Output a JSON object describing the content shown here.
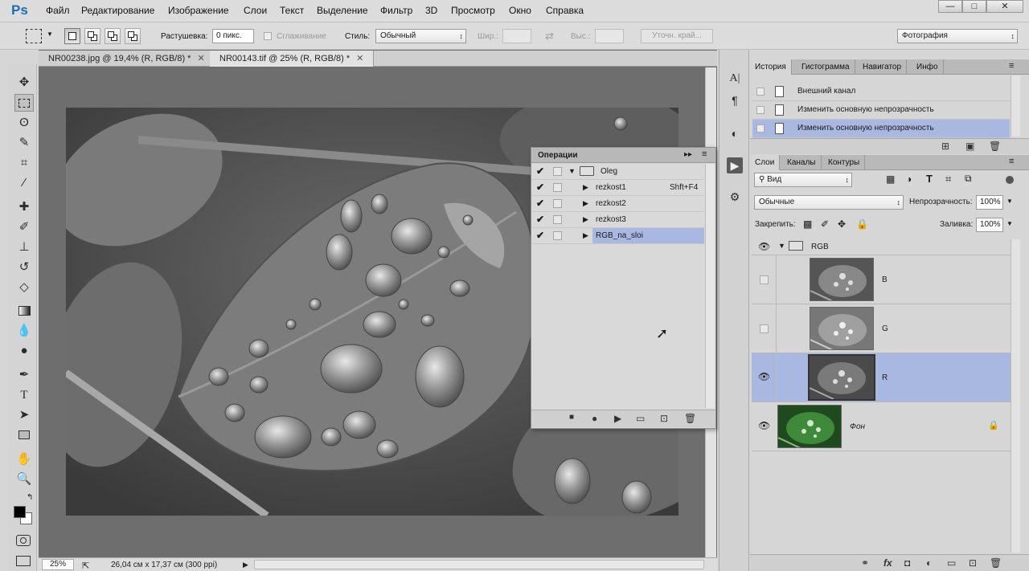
{
  "app": {
    "logo": "Ps"
  },
  "menu": [
    "Файл",
    "Редактирование",
    "Изображение",
    "Слои",
    "Текст",
    "Выделение",
    "Фильтр",
    "3D",
    "Просмотр",
    "Окно",
    "Справка"
  ],
  "window_controls": {
    "minimize": "—",
    "maximize": "□",
    "close": "✕"
  },
  "options": {
    "feather_label": "Растушевка:",
    "feather_value": "0 пикс.",
    "antialias_label": "Сглаживание",
    "style_label": "Стиль:",
    "style_value": "Обычный",
    "width_label": "Шир.:",
    "height_label": "Выс.:",
    "refine_edge_label": "Уточн. край...",
    "workspace_value": "Фотография"
  },
  "document_tabs": [
    {
      "label": "NR00238.jpg @ 19,4% (R, RGB/8) *",
      "close": "✕",
      "active": false
    },
    {
      "label": "NR00143.tif @ 25% (R, RGB/8) *",
      "close": "✕",
      "active": true
    }
  ],
  "status": {
    "zoom": "25%",
    "doc_info": "26,04 см x 17,37 см (300 ppi)"
  },
  "actions_panel": {
    "title": "Операции",
    "rows": [
      {
        "label": "Oleg",
        "type": "set",
        "shortcut": "",
        "selected": false
      },
      {
        "label": "rezkost1",
        "type": "action",
        "shortcut": "Shft+F4",
        "selected": false
      },
      {
        "label": "rezkost2",
        "type": "action",
        "shortcut": "",
        "selected": false
      },
      {
        "label": "rezkost3",
        "type": "action",
        "shortcut": "",
        "selected": false
      },
      {
        "label": "RGB_na_sloi",
        "type": "action",
        "shortcut": "",
        "selected": true
      }
    ]
  },
  "history_panel": {
    "tabs": [
      "История",
      "Гистограмма",
      "Навигатор",
      "Инфо"
    ],
    "items": [
      {
        "label": "Внешний канал",
        "selected": false
      },
      {
        "label": "Изменить основную непрозрачность",
        "selected": false
      },
      {
        "label": "Изменить основную непрозрачность",
        "selected": true
      }
    ]
  },
  "layers_panel": {
    "tabs": [
      "Слои",
      "Каналы",
      "Контуры"
    ],
    "filter_value": "Вид",
    "blend_mode": "Обычные",
    "opacity_label": "Непрозрачность:",
    "opacity_value": "100%",
    "lock_label": "Закрепить:",
    "fill_label": "Заливка:",
    "fill_value": "100%",
    "group": {
      "name": "RGB"
    },
    "layers": [
      {
        "name": "B",
        "visible": false,
        "selected": false
      },
      {
        "name": "G",
        "visible": false,
        "selected": false
      },
      {
        "name": "R",
        "visible": true,
        "selected": true
      },
      {
        "name": "Фон",
        "visible": true,
        "selected": false
      }
    ]
  },
  "colors": {
    "selection": "#a8b8e0",
    "canvas_bg": "#6e6e6e",
    "logo": "#1a6fb0"
  }
}
